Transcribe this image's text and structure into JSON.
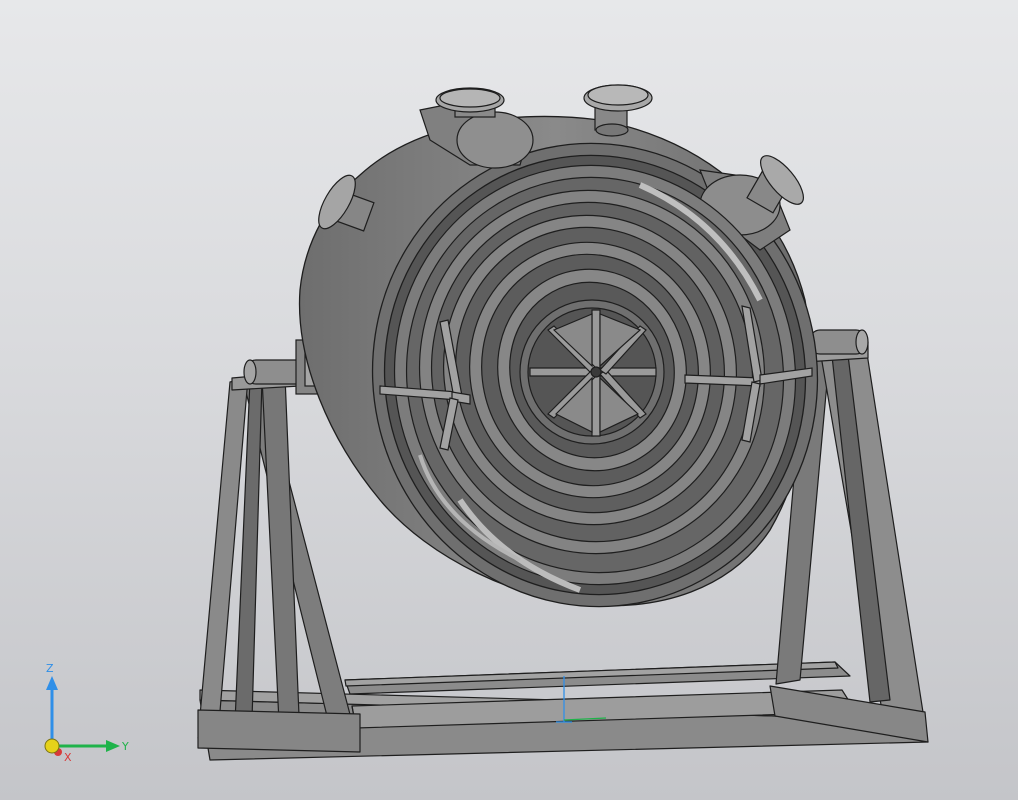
{
  "viewport": {
    "background_top": "#e7e8ea",
    "background_bottom": "#c4c5c9"
  },
  "model": {
    "shade_dark": "#5f5f5f",
    "shade_mid": "#7b7b7b",
    "shade_light": "#9a9a9a",
    "edge": "#1e1e1e"
  },
  "triad": {
    "z_label": "Z",
    "y_label": "Y",
    "x_label": "X",
    "z_color": "#2f8fe8",
    "y_color": "#1fb34a",
    "x_color": "#d83a3a",
    "origin_color": "#e6d21a"
  },
  "origin_marker": {
    "z_color": "#2f8fe8",
    "y_color": "#1fb34a"
  }
}
